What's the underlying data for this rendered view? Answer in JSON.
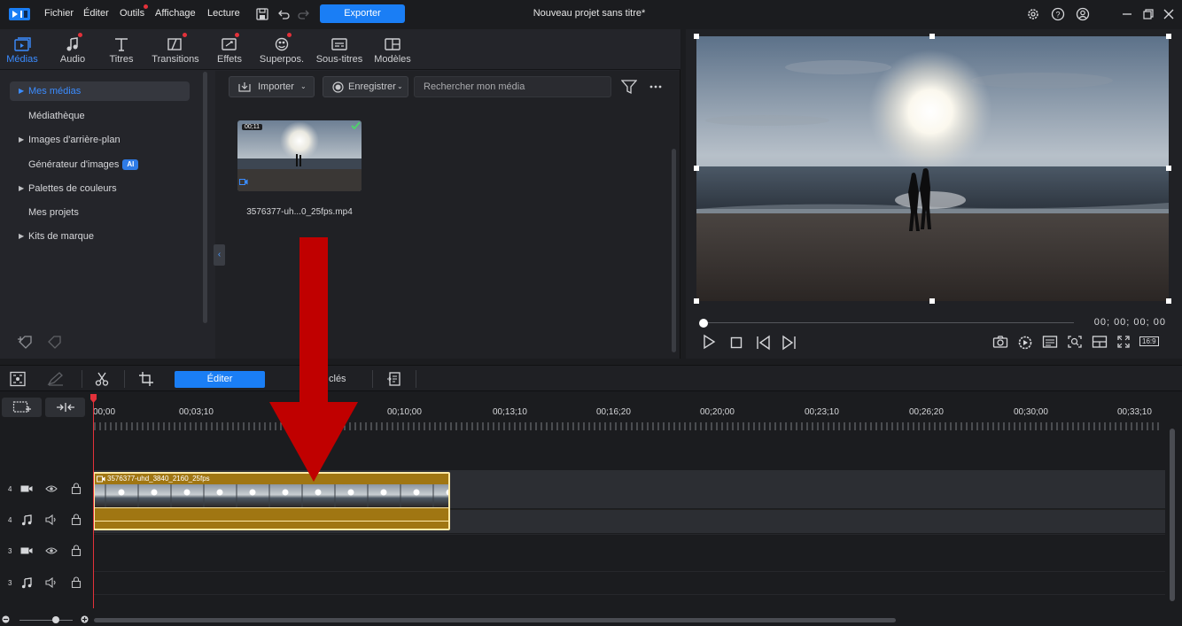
{
  "menubar": {
    "items": [
      "Fichier",
      "Éditer",
      "Outils",
      "Affichage",
      "Lecture"
    ],
    "export_label": "Exporter",
    "project_title": "Nouveau projet sans titre*"
  },
  "tabs": [
    {
      "label": "Médias",
      "icon": "media-icon"
    },
    {
      "label": "Audio",
      "icon": "music-note-icon"
    },
    {
      "label": "Titres",
      "icon": "title-t-icon"
    },
    {
      "label": "Transitions",
      "icon": "transition-icon"
    },
    {
      "label": "Effets",
      "icon": "effects-icon"
    },
    {
      "label": "Superpos.",
      "icon": "overlay-icon"
    },
    {
      "label": "Sous-titres",
      "icon": "subtitles-icon"
    },
    {
      "label": "Modèles",
      "icon": "templates-icon"
    }
  ],
  "sidebar": {
    "items": [
      {
        "label": "Mes médias"
      },
      {
        "label": "Médiathèque"
      },
      {
        "label": "Images d'arrière-plan"
      },
      {
        "label": "Générateur d'images",
        "badge": "AI"
      },
      {
        "label": "Palettes de couleurs"
      },
      {
        "label": "Mes projets"
      },
      {
        "label": "Kits de marque"
      }
    ]
  },
  "library": {
    "import_label": "Importer",
    "record_label": "Enregistrer",
    "search_placeholder": "Rechercher mon média",
    "media": {
      "duration": "00;11",
      "filename": "3576377-uh...0_25fps.mp4"
    }
  },
  "preview": {
    "timecode": "00; 00; 00; 00",
    "aspect": "16:9"
  },
  "timeline": {
    "edit_label": "Éditer",
    "keys_label": "clés",
    "ruler": [
      "00;00",
      "00;03;10",
      "00;10;00",
      "00;13;10",
      "00;16;20",
      "00;20;00",
      "00;23;10",
      "00;26;20",
      "00;30;00",
      "00;33;10"
    ],
    "tracks": [
      {
        "num": "4",
        "type": "video"
      },
      {
        "num": "4",
        "type": "audio"
      },
      {
        "num": "3",
        "type": "video"
      },
      {
        "num": "3",
        "type": "audio"
      }
    ],
    "clip_title": "3576377-uhd_3840_2160_25fps"
  },
  "colors": {
    "accent": "#1a7ef5",
    "clip": "#a07612",
    "playhead": "#e3313a",
    "arrow": "#c00000"
  }
}
